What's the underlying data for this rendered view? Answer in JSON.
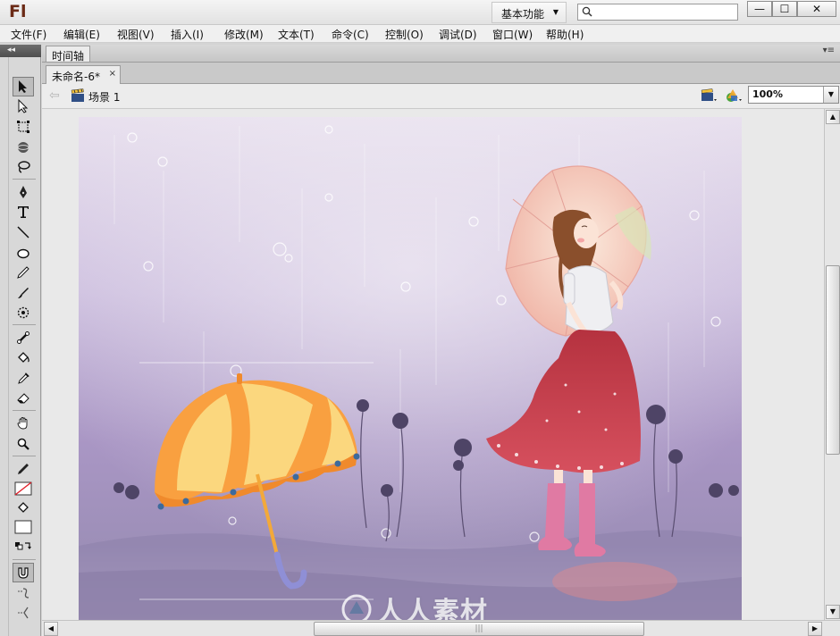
{
  "app": {
    "logo": "Fl"
  },
  "titlebar": {
    "workspace": "基本功能",
    "search": {
      "value": "",
      "placeholder": ""
    },
    "window_buttons": {
      "minimize": "—",
      "maximize": "☐",
      "close": "✕"
    }
  },
  "menu": {
    "items": [
      "文件(F)",
      "编辑(E)",
      "视图(V)",
      "插入(I)",
      "修改(M)",
      "文本(T)",
      "命令(C)",
      "控制(O)",
      "调试(D)",
      "窗口(W)",
      "帮助(H)"
    ]
  },
  "panels": {
    "timeline_tab": "时间轴",
    "tools_collapse": "◂◂",
    "panel_menu": "▾≡"
  },
  "tools": [
    {
      "name": "selection-tool",
      "active": true
    },
    {
      "name": "subselection-tool"
    },
    {
      "name": "free-transform-tool"
    },
    {
      "name": "3d-rotation-tool"
    },
    {
      "name": "lasso-tool"
    },
    {
      "name": "pen-tool"
    },
    {
      "name": "text-tool"
    },
    {
      "name": "line-tool"
    },
    {
      "name": "oval-tool"
    },
    {
      "name": "pencil-tool"
    },
    {
      "name": "brush-tool"
    },
    {
      "name": "deco-tool"
    },
    {
      "name": "bone-tool"
    },
    {
      "name": "paint-bucket-tool"
    },
    {
      "name": "eyedropper-tool"
    },
    {
      "name": "eraser-tool"
    },
    {
      "name": "hand-tool"
    },
    {
      "name": "zoom-tool"
    },
    {
      "name": "stroke-color"
    },
    {
      "name": "fill-color"
    },
    {
      "name": "swap-colors"
    },
    {
      "name": "snap-to-objects"
    },
    {
      "name": "smooth-option"
    },
    {
      "name": "straighten-option"
    }
  ],
  "document": {
    "tab_title": "未命名-6*",
    "tab_close": "×",
    "scene_label": "场景 1",
    "zoom": "100%"
  },
  "scrollbars": {
    "v_up": "▲",
    "v_down": "▼",
    "h_left": "◀",
    "h_right": "▶",
    "grip": "|||"
  },
  "watermark": {
    "text": "人人素材"
  },
  "colors": {
    "stage_bg": "#b9a9cf",
    "umbrella_orange": "#f9a040",
    "umbrella_yellow": "#fbd77e",
    "umbrella_handle": "#8f8fd6",
    "skirt_red": "#c63a4b",
    "boots_pink": "#e07aa3"
  }
}
